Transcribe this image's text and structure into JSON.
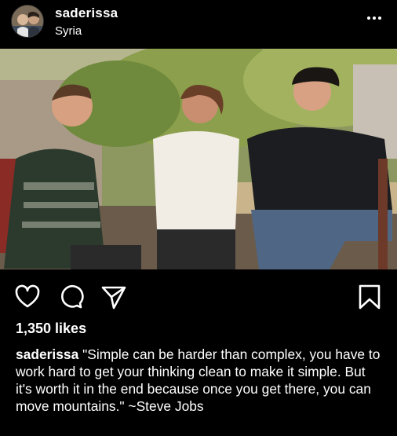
{
  "post": {
    "username": "saderissa",
    "location": "Syria",
    "likes": "1,350 likes",
    "caption": "\"Simple can be harder than complex, you have to work hard to get your thinking clean to make it simple. But it's worth it in the end because once you get there, you can move mountains.\" ~Steve Jobs"
  },
  "icons": {
    "more": "more-options-icon",
    "like": "heart-icon",
    "comment": "comment-icon",
    "share": "send-icon",
    "save": "bookmark-icon"
  },
  "colors": {
    "background": "#000000",
    "text": "#ffffff"
  }
}
